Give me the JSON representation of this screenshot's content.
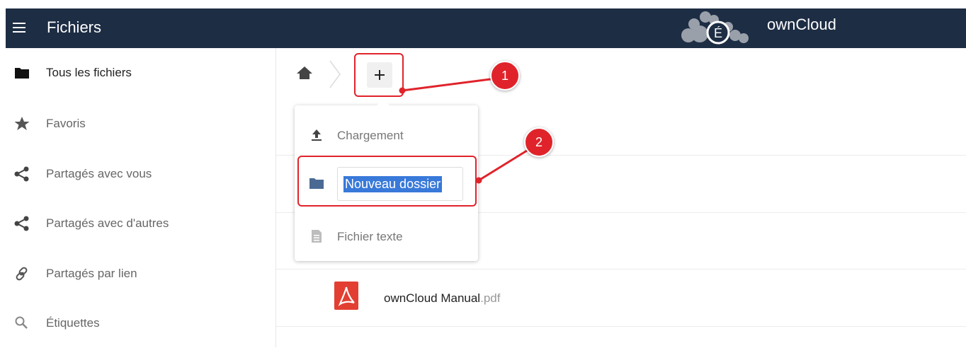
{
  "header": {
    "app_title": "Fichiers",
    "brand": "ownCloud",
    "logo_letter": "É",
    "colors": {
      "background": "#1d2d44",
      "text": "#ffffff"
    }
  },
  "sidebar": {
    "items": [
      {
        "label": "Tous les fichiers",
        "icon": "folder-icon",
        "active": true
      },
      {
        "label": "Favoris",
        "icon": "star-icon",
        "active": false
      },
      {
        "label": "Partagés avec vous",
        "icon": "share-icon",
        "active": false
      },
      {
        "label": "Partagés avec d'autres",
        "icon": "share-icon",
        "active": false
      },
      {
        "label": "Partagés par lien",
        "icon": "link-icon",
        "active": false
      },
      {
        "label": "Étiquettes",
        "icon": "search-icon",
        "active": false
      }
    ]
  },
  "breadcrumb": {
    "home_icon": "home-icon",
    "add_icon": "plus-icon"
  },
  "new_menu": {
    "upload_label": "Chargement",
    "folder_input_value": "Nouveau dossier",
    "text_file_label": "Fichier texte"
  },
  "files": [
    {
      "name": "ownCloud Manual",
      "extension": ".pdf",
      "icon": "pdf-icon"
    }
  ],
  "annotations": {
    "callout_1": "1",
    "callout_2": "2",
    "color": "#e0232b"
  },
  "colors": {
    "selection": "#3879d9",
    "folder": "#4a6a93",
    "pdf": "#e23f32"
  }
}
